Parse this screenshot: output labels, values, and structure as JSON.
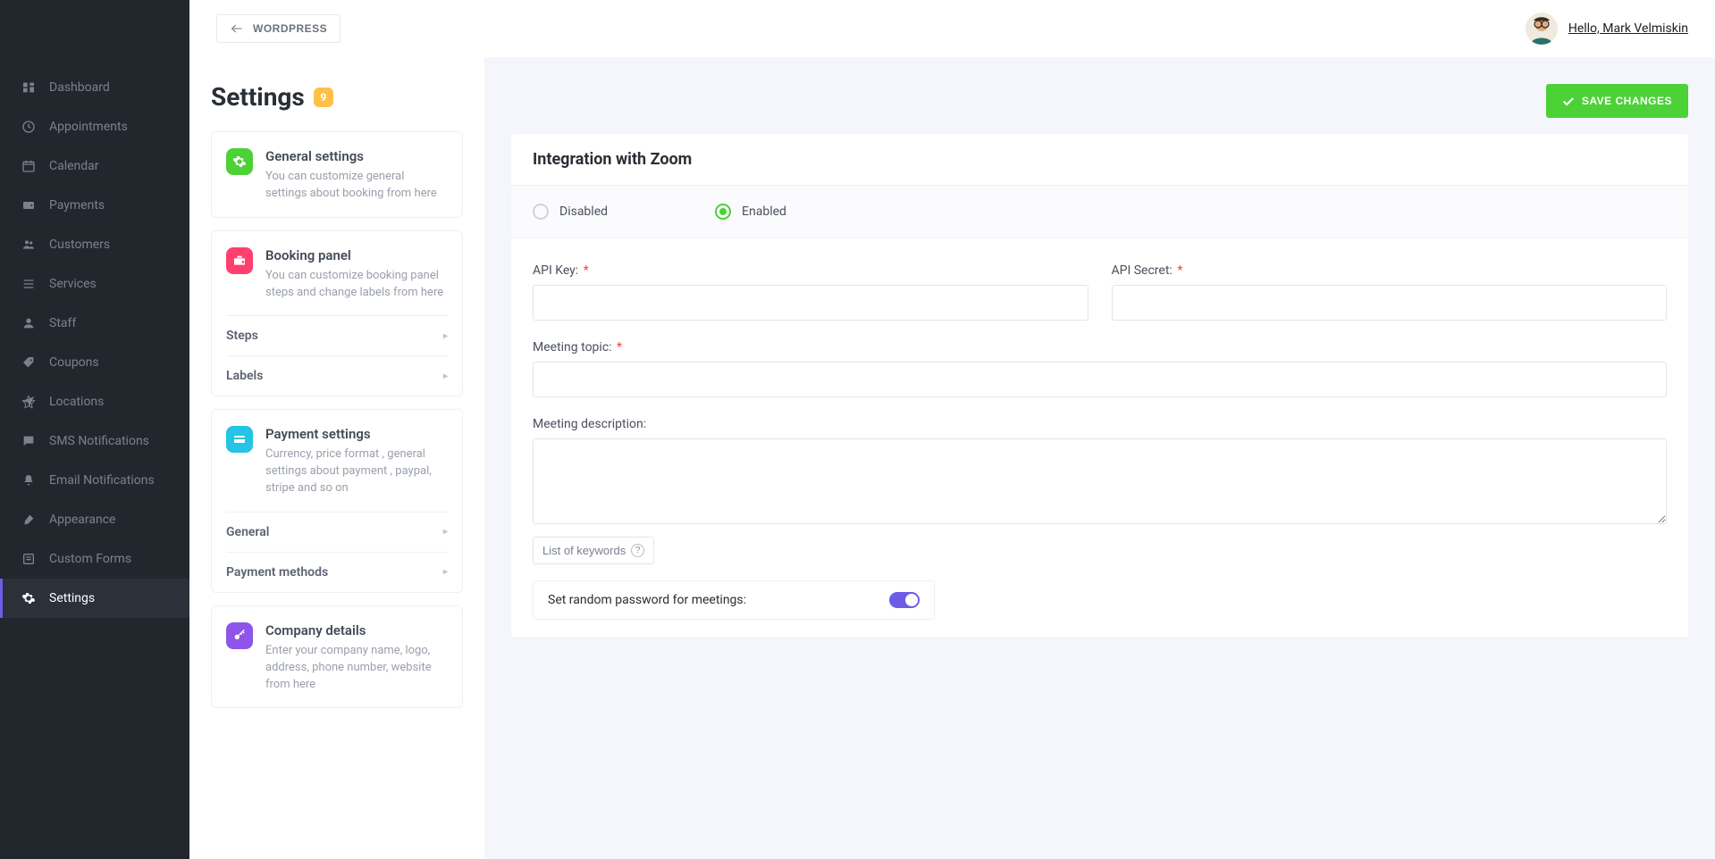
{
  "header": {
    "wordpress_button": "WORDPRESS",
    "greeting": "Hello, Mark Velmiskin"
  },
  "sidebar": {
    "items": [
      {
        "label": "Dashboard",
        "icon": "dashboard"
      },
      {
        "label": "Appointments",
        "icon": "clock"
      },
      {
        "label": "Calendar",
        "icon": "calendar"
      },
      {
        "label": "Payments",
        "icon": "wallet"
      },
      {
        "label": "Customers",
        "icon": "users"
      },
      {
        "label": "Services",
        "icon": "list"
      },
      {
        "label": "Staff",
        "icon": "user"
      },
      {
        "label": "Coupons",
        "icon": "tag"
      },
      {
        "label": "Locations",
        "icon": "location"
      },
      {
        "label": "SMS Notifications",
        "icon": "sms"
      },
      {
        "label": "Email Notifications",
        "icon": "bell"
      },
      {
        "label": "Appearance",
        "icon": "brush"
      },
      {
        "label": "Custom Forms",
        "icon": "forms"
      },
      {
        "label": "Settings",
        "icon": "gear"
      }
    ],
    "active_index": 13
  },
  "settings": {
    "title": "Settings",
    "badge": "9",
    "cards": {
      "general": {
        "title": "General settings",
        "desc": "You can customize general settings about booking from here"
      },
      "booking": {
        "title": "Booking panel",
        "desc": "You can customize booking panel steps and change labels from here",
        "subs": [
          "Steps",
          "Labels"
        ]
      },
      "payment": {
        "title": "Payment settings",
        "desc": "Currency, price format , general settings about payment , paypal, stripe and so on",
        "subs": [
          "General",
          "Payment methods"
        ]
      },
      "company": {
        "title": "Company details",
        "desc": "Enter your company name, logo, address, phone number, website from here"
      }
    }
  },
  "panel": {
    "save_button": "SAVE CHANGES",
    "title": "Integration with Zoom",
    "radio_disabled": "Disabled",
    "radio_enabled": "Enabled",
    "radio_selected": "enabled",
    "fields": {
      "api_key": {
        "label": "API Key:",
        "required": true,
        "value": ""
      },
      "api_secret": {
        "label": "API Secret:",
        "required": true,
        "value": ""
      },
      "meeting_topic": {
        "label": "Meeting topic:",
        "required": true,
        "value": ""
      },
      "meeting_description": {
        "label": "Meeting description:",
        "value": ""
      }
    },
    "keywords_button": "List of keywords",
    "toggle_random_password": {
      "label": "Set random password for meetings:",
      "on": true
    }
  }
}
